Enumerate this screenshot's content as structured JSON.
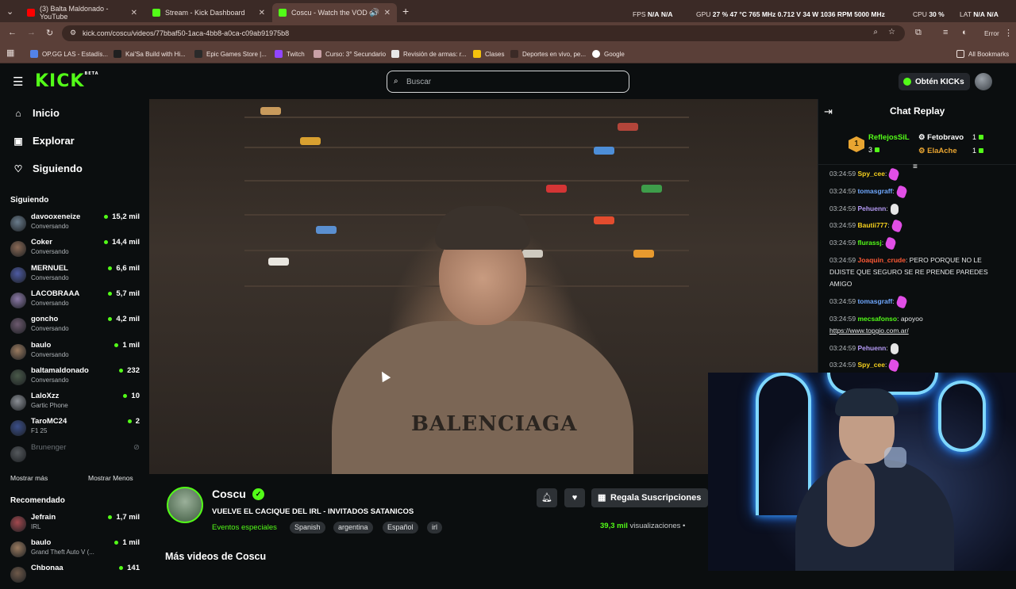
{
  "browser": {
    "tabs": [
      {
        "label": "(3) Balta Maldonado - YouTube",
        "active": false
      },
      {
        "label": "Stream - Kick Dashboard",
        "active": false
      },
      {
        "label": "Coscu - Watch the VOD on",
        "active": true
      }
    ],
    "url": "kick.com/coscu/videos/77bbaf50-1aca-4bb8-a0ca-c09ab91975b8",
    "error_label": "Error",
    "bookmarks": [
      "OP.GG LAS - Estadís...",
      "Kai'Sa Build with Hi...",
      "Epic Games Store |...",
      "Twitch",
      "Curso: 3° Secundario",
      "Revisión de armas: r...",
      "Clases",
      "Deportes en vivo, pe...",
      "Google"
    ],
    "all_bookmarks": "All Bookmarks"
  },
  "overlay_stats": {
    "fps_label": "FPS",
    "fps_val1": "N/A",
    "fps_val2": "N/A",
    "gpu_label": "GPU",
    "gpu_pct": "27 %",
    "gpu_temp": "47 °C",
    "gpu_clock": "765 MHz",
    "gpu_volt": "0.712 V",
    "gpu_power": "34 W",
    "gpu_rpm": "1036 RPM",
    "gpu_mem": "5000 MHz",
    "cpu_label": "CPU",
    "cpu_pct": "30 %",
    "lat_label": "LAT",
    "lat_val": "N/A",
    "lat_val2": "N/A"
  },
  "header": {
    "logo": "KICK",
    "logo_sup": "BETA",
    "search_placeholder": "Buscar",
    "kicks_button": "Obtén KICKs"
  },
  "sidebar": {
    "nav": [
      {
        "label": "Inicio",
        "icon": "home-icon"
      },
      {
        "label": "Explorar",
        "icon": "compass-icon"
      },
      {
        "label": "Siguiendo",
        "icon": "heart-icon"
      }
    ],
    "following_header": "Siguiendo",
    "following": [
      {
        "name": "davooxeneize",
        "sub": "Conversando",
        "viewers": "15,2 mil",
        "color": "#6a7c8c"
      },
      {
        "name": "Coker",
        "sub": "Conversando",
        "viewers": "14,4 mil",
        "color": "#8a6a56"
      },
      {
        "name": "MERNUEL",
        "sub": "Conversando",
        "viewers": "6,6 mil",
        "color": "#4e5ba3"
      },
      {
        "name": "LACOBRAAA",
        "sub": "Conversando",
        "viewers": "5,7 mil",
        "color": "#8c7aa8"
      },
      {
        "name": "goncho",
        "sub": "Conversando",
        "viewers": "4,2 mil",
        "color": "#6d5a6f"
      },
      {
        "name": "baulo",
        "sub": "Conversando",
        "viewers": "1 mil",
        "color": "#9a7b60"
      },
      {
        "name": "baltamaldonado",
        "sub": "Conversando",
        "viewers": "232",
        "color": "#4a5a4a"
      },
      {
        "name": "LaloXzz",
        "sub": "Gartic Phone",
        "viewers": "10",
        "color": "#8b8f95"
      },
      {
        "name": "TaroMC24",
        "sub": "F1 25",
        "viewers": "2",
        "color": "#3b4f8a"
      },
      {
        "name": "Brunenger",
        "sub": "",
        "viewers": "",
        "color": "#55595d"
      }
    ],
    "show_more": "Mostrar más",
    "show_less": "Mostrar Menos",
    "recommended_header": "Recomendado",
    "recommended": [
      {
        "name": "Jefrain",
        "sub": "IRL",
        "viewers": "1,7 mil",
        "color": "#a3494f"
      },
      {
        "name": "baulo",
        "sub": "Grand Theft Auto V (...",
        "viewers": "1 mil",
        "color": "#9a7b60"
      },
      {
        "name": "Chbonaa",
        "sub": "",
        "viewers": "141",
        "color": "#6f5a4a"
      }
    ]
  },
  "video": {
    "shirt_text": "BALENCIAGA"
  },
  "stream_info": {
    "channel": "Coscu",
    "title": "VUELVE EL CACIQUE DEL IRL - INVITADOS SATANICOS",
    "category": "Eventos especiales",
    "tags": [
      "Spanish",
      "argentina",
      "Español",
      "irl"
    ],
    "gift_button": "Regala Suscripciones",
    "views_count": "39,3 mil",
    "views_label": "visualizaciones",
    "more_videos": "Más videos de Coscu"
  },
  "chat": {
    "title": "Chat Replay",
    "top_gifters": [
      {
        "rank": "1",
        "name": "ReflejosSiL",
        "count": "3",
        "color": "#53fc18"
      },
      {
        "name": "Fetobravo",
        "count": "1",
        "color": "#ffffff"
      },
      {
        "name": "ElaAche",
        "count": "1",
        "color": "#e9a531"
      }
    ],
    "messages": [
      {
        "time": "03:24:59",
        "user": "Spy_cee",
        "color": "#f7d11e",
        "text": "",
        "emote": "pink"
      },
      {
        "time": "03:24:59",
        "user": "tomasgraff",
        "color": "#6fa8ff",
        "text": "",
        "emote": "pink"
      },
      {
        "time": "03:24:59",
        "user": "Pehuenn",
        "color": "#b59af5",
        "text": "",
        "emote": "white"
      },
      {
        "time": "03:24:59",
        "user": "Bautii777",
        "color": "#f7d11e",
        "text": "",
        "emote": "pink"
      },
      {
        "time": "03:24:59",
        "user": "flurassj",
        "color": "#53fc18",
        "text": "",
        "emote": "pink"
      },
      {
        "time": "03:24:59",
        "user": "Joaquin_crude",
        "color": "#ff5a36",
        "text": "PERO PORQUE NO LE DIJISTE QUE SEGURO SE RE PRENDE PAREDES AMIGO",
        "emote": ""
      },
      {
        "time": "03:24:59",
        "user": "tomasgraff",
        "color": "#6fa8ff",
        "text": "",
        "emote": "pink"
      },
      {
        "time": "03:24:59",
        "user": "mecsafonso",
        "color": "#53fc18",
        "text": "apoyoo",
        "emote": "",
        "link": "https://www.topgio.com.ar/"
      },
      {
        "time": "03:24:59",
        "user": "Pehuenn",
        "color": "#b59af5",
        "text": "",
        "emote": "white"
      },
      {
        "time": "03:24:59",
        "user": "Spy_cee",
        "color": "#f7d11e",
        "text": "",
        "emote": "pink"
      }
    ]
  }
}
